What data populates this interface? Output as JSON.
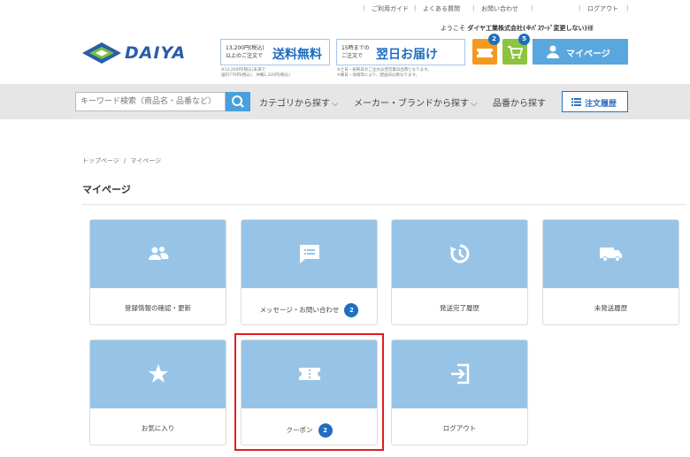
{
  "util_links": [
    "ご利用ガイド",
    "よくある質問",
    "お問い合わせ",
    "ログアウト"
  ],
  "welcome": {
    "prefix": "ようこそ",
    "name": "ダイヤ工業株式会社(※ﾊﾟｽﾜｰﾄﾞ変更しない)",
    "suffix": "様"
  },
  "logo": {
    "text": "DAIYA"
  },
  "banners": [
    {
      "small1": "13,200円(税込)",
      "small2": "以上のご注文で",
      "big": "送料無料",
      "note1": "※13,200円(税込)未満で",
      "note2": "送料770円(税込)、沖縄1,320円(税込)"
    },
    {
      "small1": "15時までの",
      "small2": "ご注文で",
      "big": "翌日お届け",
      "note1": "※土日・祝祭日のご注文は翌営業日出荷となります。",
      "note2": "※曜日・地域等により、配送日は異なります。"
    }
  ],
  "header": {
    "coupon_count": "2",
    "cart_count": "5",
    "mypage_label": "マイページ"
  },
  "search": {
    "placeholder": "キーワード検索（商品名・品番など）"
  },
  "nav": {
    "category": "カテゴリから探す",
    "maker": "メーカー・ブランドから探す",
    "part_no": "品番から探す",
    "order_history": "注文履歴"
  },
  "breadcrumb": [
    "トップページ",
    "マイページ"
  ],
  "page_title": "マイページ",
  "cards": [
    {
      "label": "登録情報の確認・更新",
      "icon": "users-icon",
      "count": ""
    },
    {
      "label": "メッセージ・お問い合わせ",
      "icon": "message-icon",
      "count": "2"
    },
    {
      "label": "発送完了履歴",
      "icon": "history-icon",
      "count": ""
    },
    {
      "label": "未発送履歴",
      "icon": "truck-icon",
      "count": ""
    },
    {
      "label": "お気に入り",
      "icon": "star-icon",
      "count": ""
    },
    {
      "label": "クーポン",
      "icon": "ticket-icon",
      "count": "2"
    },
    {
      "label": "ログアウト",
      "icon": "logout-icon",
      "count": ""
    }
  ],
  "colors": {
    "brand_blue": "#1f6ec0",
    "card_top": "#97c4e6",
    "highlight": "#e01e1e",
    "coupon": "#f39a1e",
    "cart": "#8cc33f"
  }
}
